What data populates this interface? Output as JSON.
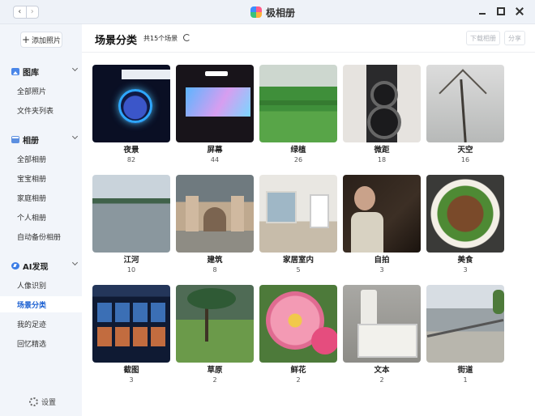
{
  "window": {
    "title": "极相册",
    "back_glyph": "‹",
    "forward_glyph": "›"
  },
  "sidebar": {
    "add_photos": "添加照片",
    "sections": [
      {
        "title": "图库",
        "icon": "gallery-icon",
        "items": [
          "全部照片",
          "文件夹列表"
        ]
      },
      {
        "title": "相册",
        "icon": "album-icon",
        "items": [
          "全部相册",
          "宝宝相册",
          "家庭相册",
          "个人相册",
          "自动备份相册"
        ]
      },
      {
        "title": "AI发现",
        "icon": "ai-discover-icon",
        "items": [
          "人像识别",
          "场景分类",
          "我的足迹",
          "回忆精选"
        ]
      }
    ],
    "active_item": "场景分类",
    "settings": "设置"
  },
  "header": {
    "title": "场景分类",
    "count_text": "共15个场景",
    "download_label": "下载相册",
    "share_label": "分享"
  },
  "categories": [
    {
      "name": "夜景",
      "count": "82"
    },
    {
      "name": "屏幕",
      "count": "44"
    },
    {
      "name": "绿植",
      "count": "26"
    },
    {
      "name": "微距",
      "count": "18"
    },
    {
      "name": "天空",
      "count": "16"
    },
    {
      "name": "江河",
      "count": "10"
    },
    {
      "name": "建筑",
      "count": "8"
    },
    {
      "name": "家居室内",
      "count": "5"
    },
    {
      "name": "自拍",
      "count": "3"
    },
    {
      "name": "美食",
      "count": "3"
    },
    {
      "name": "截图",
      "count": "3"
    },
    {
      "name": "草原",
      "count": "2"
    },
    {
      "name": "鲜花",
      "count": "2"
    },
    {
      "name": "文本",
      "count": "2"
    },
    {
      "name": "街道",
      "count": "1"
    }
  ],
  "colors": {
    "accent": "#1a5fd1",
    "sidebar_bg": "#f2f5fa",
    "titlebar_bg": "#eef2f8"
  }
}
